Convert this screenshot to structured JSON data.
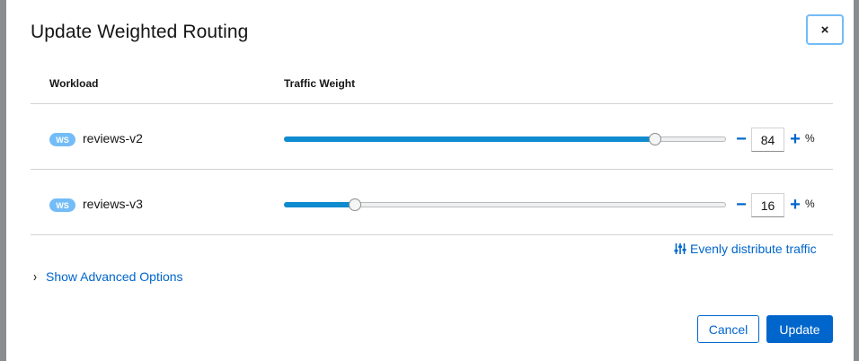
{
  "modal": {
    "title": "Update Weighted Routing",
    "close_label": "×"
  },
  "table": {
    "headers": [
      "Workload",
      "Traffic Weight"
    ],
    "rows": [
      {
        "badge": "WS",
        "name": "reviews-v2",
        "weight": "84",
        "weight_percent": 84,
        "minus": "−",
        "plus": "+",
        "unit": "%"
      },
      {
        "badge": "WS",
        "name": "reviews-v3",
        "weight": "16",
        "weight_percent": 16,
        "minus": "−",
        "plus": "+",
        "unit": "%"
      }
    ]
  },
  "actions": {
    "evenly_distribute": "Evenly distribute traffic",
    "evenly_distribute_icon": "sliders-icon",
    "advanced_options": "Show Advanced Options",
    "advanced_icon": "chevron-right-icon",
    "cancel": "Cancel",
    "update": "Update"
  },
  "colors": {
    "accent": "#0066cc",
    "slider_fill": "#0f8bcf",
    "badge": "#73bcf7"
  }
}
